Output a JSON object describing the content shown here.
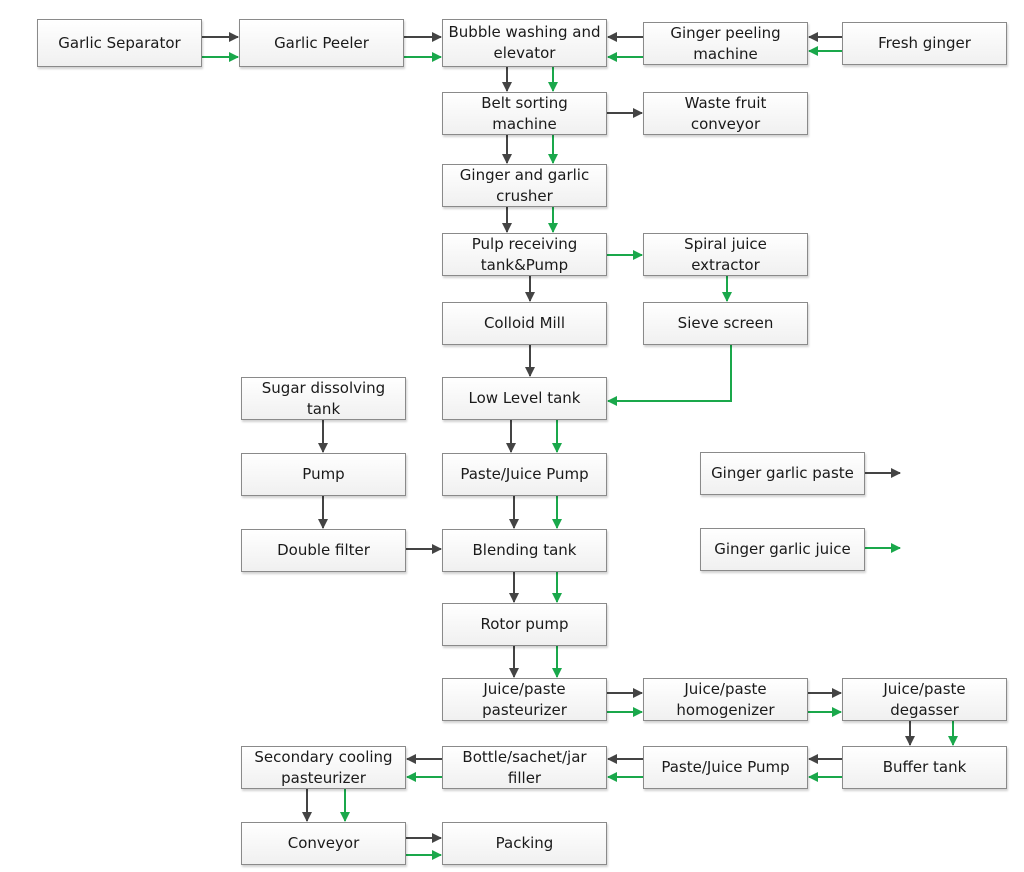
{
  "diagram": {
    "title": "",
    "colors": {
      "paste": "#444444",
      "juice": "#1aa84b"
    },
    "legend": [
      {
        "label": "Ginger garlic paste",
        "stream": "paste"
      },
      {
        "label": "Ginger garlic juice",
        "stream": "juice"
      }
    ],
    "nodes": {
      "garlic_separator": "Garlic Separator",
      "garlic_peeler": "Garlic Peeler",
      "bubble_washing": "Bubble washing and elevator",
      "ginger_peeling": "Ginger peeling machine",
      "fresh_ginger": "Fresh ginger",
      "belt_sorting": "Belt sorting machine",
      "waste_fruit": "Waste fruit conveyor",
      "crusher": "Ginger and garlic crusher",
      "pulp_tank": "Pulp receiving tank&Pump",
      "spiral_extractor": "Spiral juice extractor",
      "colloid_mill": "Colloid Mill",
      "sieve_screen": "Sieve screen",
      "sugar_tank": "Sugar dissolving tank",
      "low_level_tank": "Low Level  tank",
      "pump": "Pump",
      "paste_juice_pump_1": "Paste/Juice Pump",
      "double_filter": "Double filter",
      "blending_tank": "Blending tank",
      "rotor_pump": "Rotor pump",
      "pasteurizer": "Juice/paste pasteurizer",
      "homogenizer": "Juice/paste homogenizer",
      "degasser": "Juice/paste degasser",
      "secondary_cooling": "Secondary cooling pasteurizer",
      "filler": "Bottle/sachet/jar filler",
      "paste_juice_pump_2": "Paste/Juice Pump",
      "buffer_tank": "Buffer tank",
      "conveyor": "Conveyor",
      "packing": "Packing"
    },
    "edges": [
      {
        "from": "garlic_separator",
        "to": "garlic_peeler",
        "streams": [
          "paste",
          "juice"
        ]
      },
      {
        "from": "garlic_peeler",
        "to": "bubble_washing",
        "streams": [
          "paste",
          "juice"
        ]
      },
      {
        "from": "fresh_ginger",
        "to": "ginger_peeling",
        "streams": [
          "paste",
          "juice"
        ]
      },
      {
        "from": "ginger_peeling",
        "to": "bubble_washing",
        "streams": [
          "paste",
          "juice"
        ]
      },
      {
        "from": "bubble_washing",
        "to": "belt_sorting",
        "streams": [
          "paste",
          "juice"
        ]
      },
      {
        "from": "belt_sorting",
        "to": "waste_fruit",
        "streams": [
          "paste"
        ]
      },
      {
        "from": "belt_sorting",
        "to": "crusher",
        "streams": [
          "paste",
          "juice"
        ]
      },
      {
        "from": "crusher",
        "to": "pulp_tank",
        "streams": [
          "paste",
          "juice"
        ]
      },
      {
        "from": "pulp_tank",
        "to": "spiral_extractor",
        "streams": [
          "juice"
        ]
      },
      {
        "from": "pulp_tank",
        "to": "colloid_mill",
        "streams": [
          "paste"
        ]
      },
      {
        "from": "spiral_extractor",
        "to": "sieve_screen",
        "streams": [
          "juice"
        ]
      },
      {
        "from": "colloid_mill",
        "to": "low_level_tank",
        "streams": [
          "paste"
        ]
      },
      {
        "from": "sieve_screen",
        "to": "low_level_tank",
        "streams": [
          "juice"
        ]
      },
      {
        "from": "low_level_tank",
        "to": "paste_juice_pump_1",
        "streams": [
          "paste",
          "juice"
        ]
      },
      {
        "from": "sugar_tank",
        "to": "pump",
        "streams": [
          "paste"
        ]
      },
      {
        "from": "pump",
        "to": "double_filter",
        "streams": [
          "paste"
        ]
      },
      {
        "from": "double_filter",
        "to": "blending_tank",
        "streams": [
          "paste"
        ]
      },
      {
        "from": "paste_juice_pump_1",
        "to": "blending_tank",
        "streams": [
          "paste",
          "juice"
        ]
      },
      {
        "from": "blending_tank",
        "to": "rotor_pump",
        "streams": [
          "paste",
          "juice"
        ]
      },
      {
        "from": "rotor_pump",
        "to": "pasteurizer",
        "streams": [
          "paste",
          "juice"
        ]
      },
      {
        "from": "pasteurizer",
        "to": "homogenizer",
        "streams": [
          "paste",
          "juice"
        ]
      },
      {
        "from": "homogenizer",
        "to": "degasser",
        "streams": [
          "paste",
          "juice"
        ]
      },
      {
        "from": "degasser",
        "to": "buffer_tank",
        "streams": [
          "paste",
          "juice"
        ]
      },
      {
        "from": "buffer_tank",
        "to": "paste_juice_pump_2",
        "streams": [
          "paste",
          "juice"
        ]
      },
      {
        "from": "paste_juice_pump_2",
        "to": "filler",
        "streams": [
          "paste",
          "juice"
        ]
      },
      {
        "from": "filler",
        "to": "secondary_cooling",
        "streams": [
          "paste",
          "juice"
        ]
      },
      {
        "from": "secondary_cooling",
        "to": "conveyor",
        "streams": [
          "paste",
          "juice"
        ]
      },
      {
        "from": "conveyor",
        "to": "packing",
        "streams": [
          "paste",
          "juice"
        ]
      }
    ]
  }
}
